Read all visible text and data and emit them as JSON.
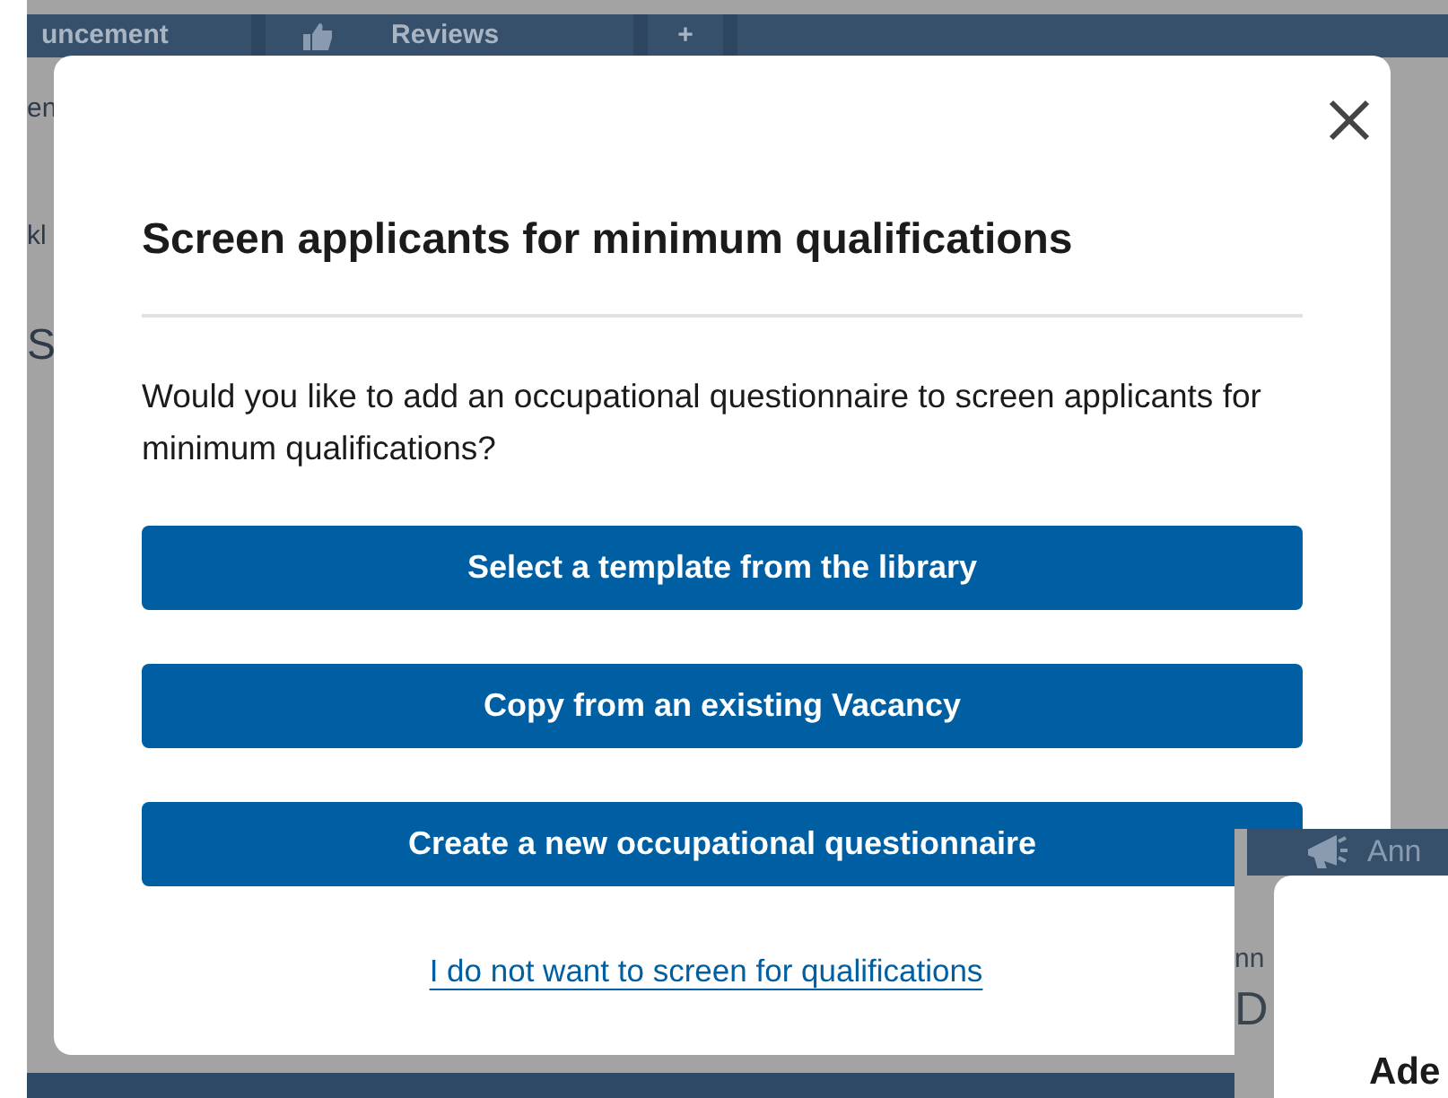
{
  "background": {
    "nav_tabs": [
      {
        "label": "uncement",
        "kind": "text"
      },
      {
        "label": "Reviews",
        "kind": "thumb"
      },
      {
        "label": "+",
        "kind": "text"
      }
    ],
    "side_texts": [
      "en",
      "kl",
      "S"
    ]
  },
  "dialog": {
    "title": "Screen applicants for minimum qualifications",
    "message": "Would you like to add an occupational questionnaire to screen applicants for minimum qualifications?",
    "buttons": [
      "Select a template from the library",
      "Copy from an existing Vacancy",
      "Create a new occupational questionnaire"
    ],
    "link": "I do not want to screen for qualifications"
  },
  "inset": {
    "tab": "Ann",
    "side_texts": [
      "nn",
      "D"
    ],
    "heading": "Ade"
  }
}
